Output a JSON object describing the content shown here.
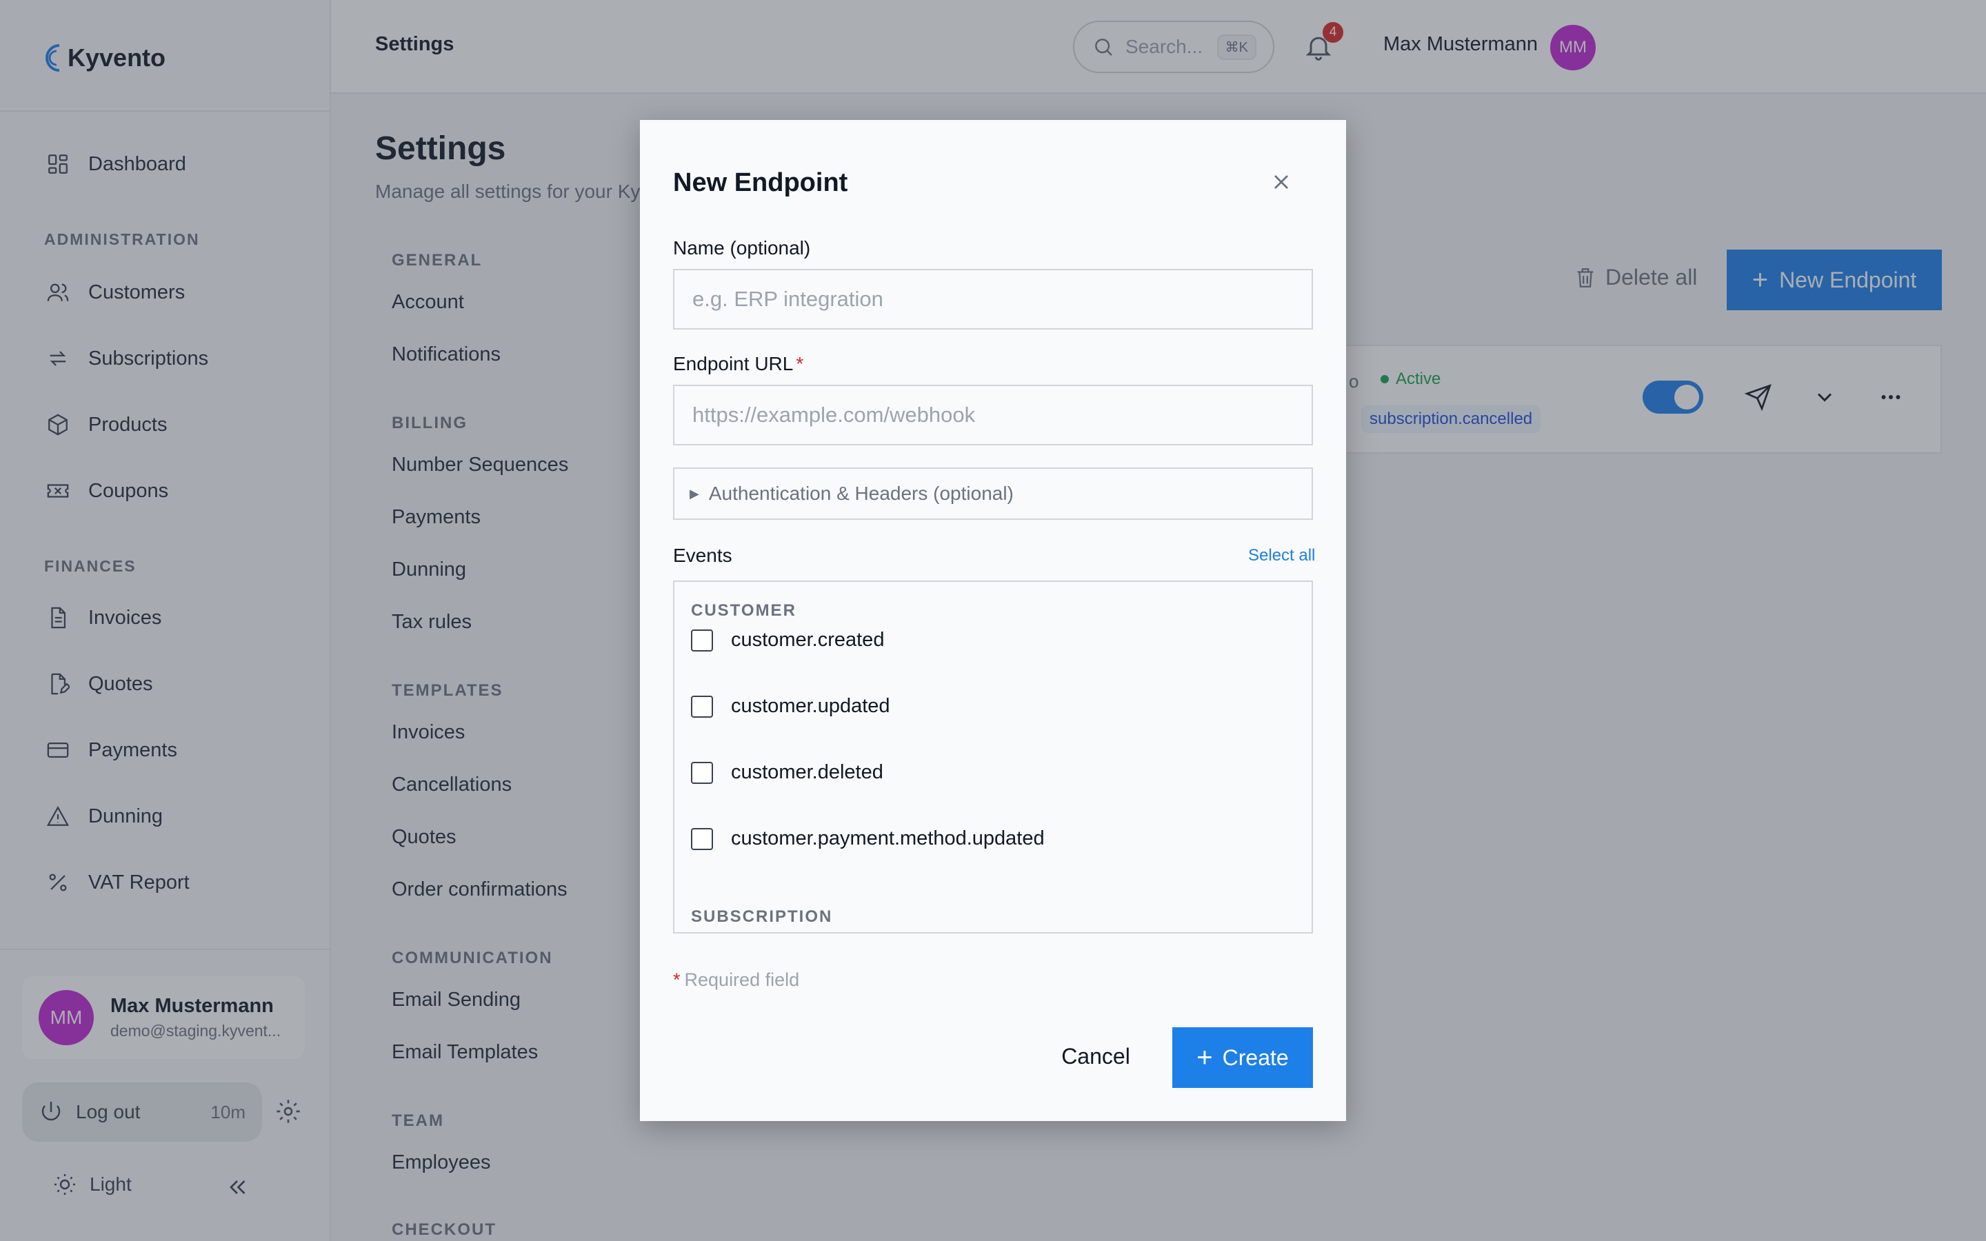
{
  "brand": {
    "name": "Kyvento",
    "accent": "#1d7fe8",
    "avatar_color": "#c026d3"
  },
  "sidebar": {
    "top_items": [
      {
        "label": "Dashboard",
        "icon": "dashboard-icon"
      }
    ],
    "sections": [
      {
        "title": "ADMINISTRATION",
        "items": [
          {
            "label": "Customers",
            "icon": "users-icon"
          },
          {
            "label": "Subscriptions",
            "icon": "repeat-icon"
          },
          {
            "label": "Products",
            "icon": "box-icon"
          },
          {
            "label": "Coupons",
            "icon": "ticket-icon"
          }
        ]
      },
      {
        "title": "FINANCES",
        "items": [
          {
            "label": "Invoices",
            "icon": "document-icon"
          },
          {
            "label": "Quotes",
            "icon": "document-edit-icon"
          },
          {
            "label": "Payments",
            "icon": "credit-card-icon"
          },
          {
            "label": "Dunning",
            "icon": "warning-icon"
          },
          {
            "label": "VAT Report",
            "icon": "percent-icon"
          }
        ]
      }
    ],
    "user": {
      "initials": "MM",
      "name": "Max Mustermann",
      "email": "demo@staging.kyvent..."
    },
    "logout": {
      "label": "Log out",
      "timer": "10m"
    },
    "theme": {
      "label": "Light"
    }
  },
  "topbar": {
    "title": "Settings",
    "search": {
      "placeholder": "Search...",
      "shortcut": "⌘K"
    },
    "notifications": {
      "count": "4"
    },
    "user": {
      "name": "Max Mustermann",
      "initials": "MM"
    }
  },
  "settings": {
    "title": "Settings",
    "subtitle": "Manage all settings for your Kyv",
    "sections": [
      {
        "title": "GENERAL",
        "items": [
          "Account",
          "Notifications"
        ]
      },
      {
        "title": "BILLING",
        "items": [
          "Number Sequences",
          "Payments",
          "Dunning",
          "Tax rules"
        ]
      },
      {
        "title": "TEMPLATES",
        "items": [
          "Invoices",
          "Cancellations",
          "Quotes",
          "Order confirmations"
        ]
      },
      {
        "title": "COMMUNICATION",
        "items": [
          "Email Sending",
          "Email Templates"
        ]
      },
      {
        "title": "TEAM",
        "items": [
          "Employees"
        ]
      },
      {
        "title": "CHECKOUT",
        "items": []
      }
    ]
  },
  "webhooks": {
    "delete_all_label": "Delete all",
    "new_endpoint_label": "New Endpoint",
    "endpoint": {
      "fragment": "o",
      "status": "Active",
      "status_color": "#16a34a",
      "event_tag": "subscription.cancelled",
      "enabled": true
    }
  },
  "modal": {
    "title": "New Endpoint",
    "name_label": "Name (optional)",
    "name_placeholder": "e.g. ERP integration",
    "url_label": "Endpoint URL",
    "url_required_mark": "*",
    "url_placeholder": "https://example.com/webhook",
    "auth_label": "Authentication & Headers (optional)",
    "events_label": "Events",
    "select_all_label": "Select all",
    "event_groups": [
      {
        "title": "CUSTOMER",
        "events": [
          {
            "name": "customer.created",
            "checked": false
          },
          {
            "name": "customer.updated",
            "checked": false
          },
          {
            "name": "customer.deleted",
            "checked": false
          },
          {
            "name": "customer.payment.method.updated",
            "checked": false
          }
        ]
      },
      {
        "title": "SUBSCRIPTION",
        "events": []
      }
    ],
    "required_note_mark": "*",
    "required_note": "Required field",
    "cancel_label": "Cancel",
    "create_label": "Create"
  }
}
